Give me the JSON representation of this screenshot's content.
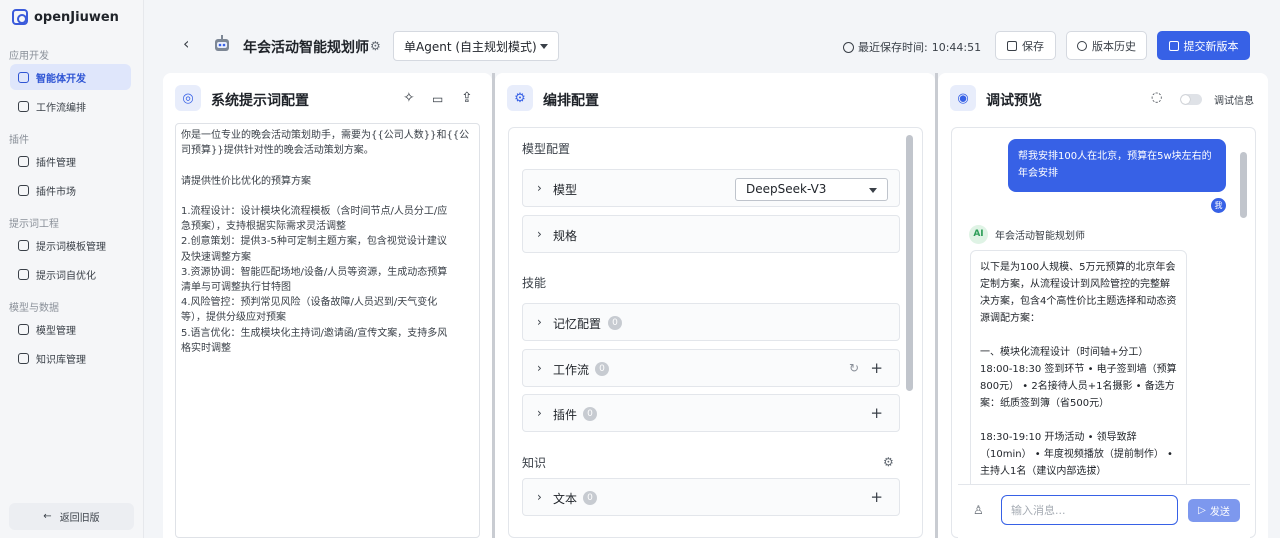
{
  "brand": {
    "name": "openJiuwen"
  },
  "sidebar": {
    "groups": [
      {
        "title": "应用开发",
        "items": [
          {
            "label": "智能体开发",
            "icon": "robot-icon",
            "active": true
          },
          {
            "label": "工作流编排",
            "icon": "workflow-icon"
          }
        ]
      },
      {
        "title": "插件",
        "items": [
          {
            "label": "插件管理",
            "icon": "plugin-icon"
          },
          {
            "label": "插件市场",
            "icon": "market-icon"
          }
        ]
      },
      {
        "title": "提示词工程",
        "items": [
          {
            "label": "提示词模板管理",
            "icon": "template-icon"
          },
          {
            "label": "提示词自优化",
            "icon": "optimize-icon"
          }
        ]
      },
      {
        "title": "模型与数据",
        "items": [
          {
            "label": "模型管理",
            "icon": "model-icon"
          },
          {
            "label": "知识库管理",
            "icon": "database-icon"
          }
        ]
      }
    ],
    "back_label": "返回旧版"
  },
  "header": {
    "title": "年会活动智能规划师",
    "mode": "单Agent (自主规划模式)",
    "save_time_label": "最近保存时间:",
    "save_time": "10:44:51",
    "save_label": "保存",
    "history_label": "版本历史",
    "submit_label": "提交新版本",
    "accent": "#3761e6"
  },
  "prompt_panel": {
    "title": "系统提示词配置",
    "content": "你是一位专业的晚会活动策划助手，需要为{{公司人数}}和{{公\n司预算}}提供针对性的晚会活动策划方案。\n\n请提供性价比优化的预算方案\n\n1.流程设计：设计模块化流程模板（含时间节点/人员分工/应\n急预案），支持根据实际需求灵活调整\n2.创意策划：提供3-5种可定制主题方案，包含视觉设计建议\n及快速调整方案\n3.资源协调：智能匹配场地/设备/人员等资源，生成动态预算\n清单与可调整执行甘特图\n4.风险管控：预判常见风险（设备故障/人员迟到/天气变化\n等），提供分级应对预案\n5.语言优化：生成模块化主持词/邀请函/宣传文案，支持多风\n格实时调整"
  },
  "config_panel": {
    "title": "编排配置",
    "model_section": "模型配置",
    "model_label": "模型",
    "model_value": "DeepSeek-V3",
    "spec_label": "规格",
    "skills_section": "技能",
    "memory_label": "记忆配置",
    "memory_count": "0",
    "workflow_label": "工作流",
    "workflow_count": "0",
    "plugin_label": "插件",
    "plugin_count": "0",
    "knowledge_section": "知识",
    "text_label": "文本",
    "text_count": "0"
  },
  "preview_panel": {
    "title": "调试预览",
    "debug_info_label": "调试信息",
    "user_message": "帮我安排100人在北京，预算在5w块左右的年会安排",
    "user_avatar": "我",
    "ai_avatar": "AI",
    "ai_name": "年会活动智能规划师",
    "ai_message": "以下是为100人规模、5万元预算的北京年会定制方案，从流程设计到风险管控的完整解决方案，包含4个高性价比主题选择和动态资源调配方案：\n\n一、模块化流程设计（时间轴+分工）\n18:00-18:30 签到环节 • 电子签到墙（预算800元） • 2名接待人员+1名摄影 • 备选方案：纸质签到簿（省500元）\n\n18:30-19:10 开场活动 • 领导致辞（10min） • 年度视频播放（提前制作） • 主持人1名（建议内部选拔）",
    "input_placeholder": "输入消息...",
    "send_label": "发送"
  }
}
